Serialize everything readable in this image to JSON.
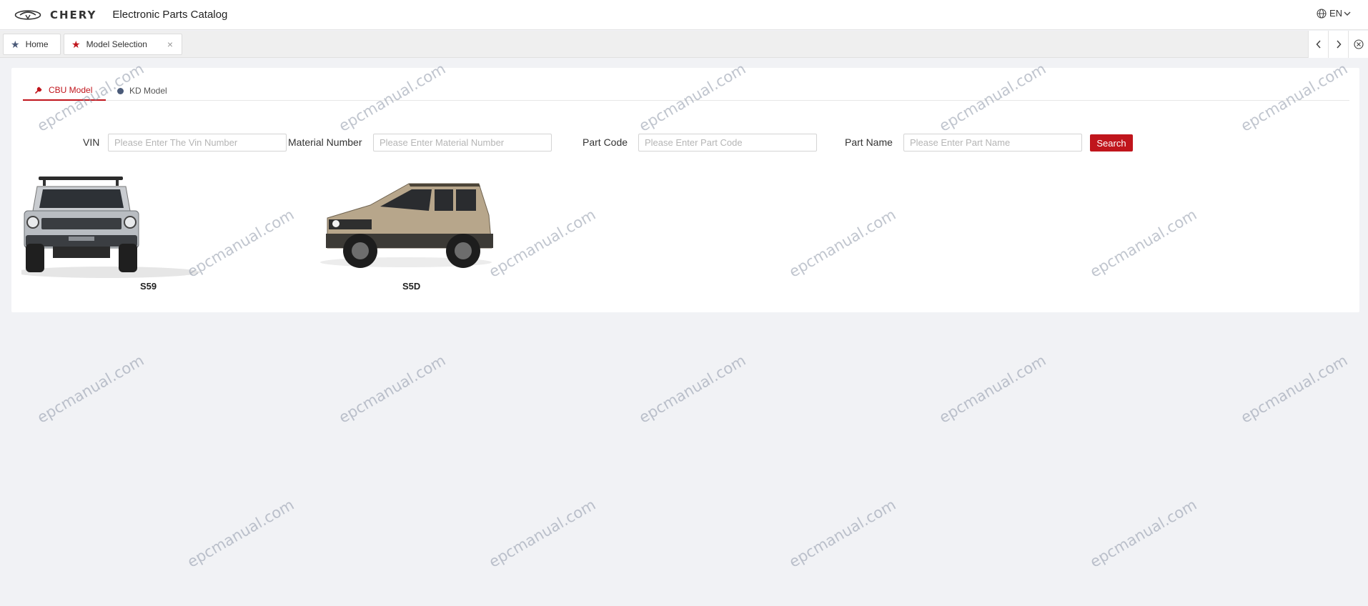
{
  "header": {
    "brand": "CHERY",
    "title": "Electronic Parts Catalog",
    "language": "EN"
  },
  "tabs": [
    {
      "label": "Home"
    },
    {
      "label": "Model Selection"
    }
  ],
  "model_tabs": [
    {
      "label": "CBU Model",
      "active": true
    },
    {
      "label": "KD Model",
      "active": false
    }
  ],
  "search": {
    "vin": {
      "label": "VIN",
      "placeholder": "Please Enter The Vin Number",
      "value": ""
    },
    "material": {
      "label": "Material Number",
      "placeholder": "Please Enter Material Number",
      "value": ""
    },
    "part_code": {
      "label": "Part Code",
      "placeholder": "Please Enter Part Code",
      "value": ""
    },
    "part_name": {
      "label": "Part Name",
      "placeholder": "Please Enter Part Name",
      "value": ""
    },
    "button_label": "Search"
  },
  "models": [
    {
      "name": "S59"
    },
    {
      "name": "S5D"
    }
  ],
  "watermark": "epcmanual.com",
  "colors": {
    "accent": "#c0151c",
    "navy": "#4a5a78",
    "background": "#f1f2f5"
  }
}
